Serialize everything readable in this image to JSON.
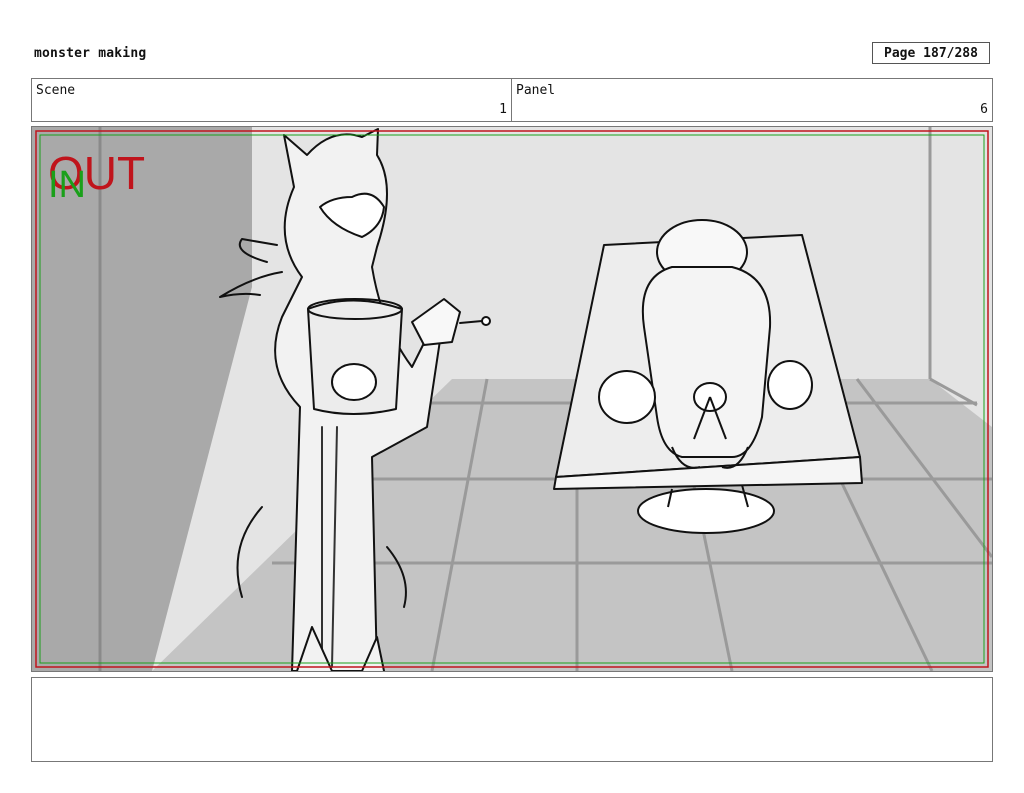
{
  "header": {
    "title": "monster making",
    "page": "Page 187/288"
  },
  "scene_bar": {
    "scene_label": "Scene",
    "scene_value": "1",
    "panel_label": "Panel",
    "panel_value": "6"
  },
  "frame": {
    "out_label": "OUT",
    "in_label": "IN",
    "colors": {
      "out": "#c0141c",
      "in": "#1aa01a",
      "wall_dark": "#a9a9a9",
      "wall_light": "#e4e4e4",
      "floor": "#c4c4c4",
      "floor_lines": "#9a9a9a",
      "sketch": "#111111"
    }
  },
  "notes": {
    "text": ""
  }
}
